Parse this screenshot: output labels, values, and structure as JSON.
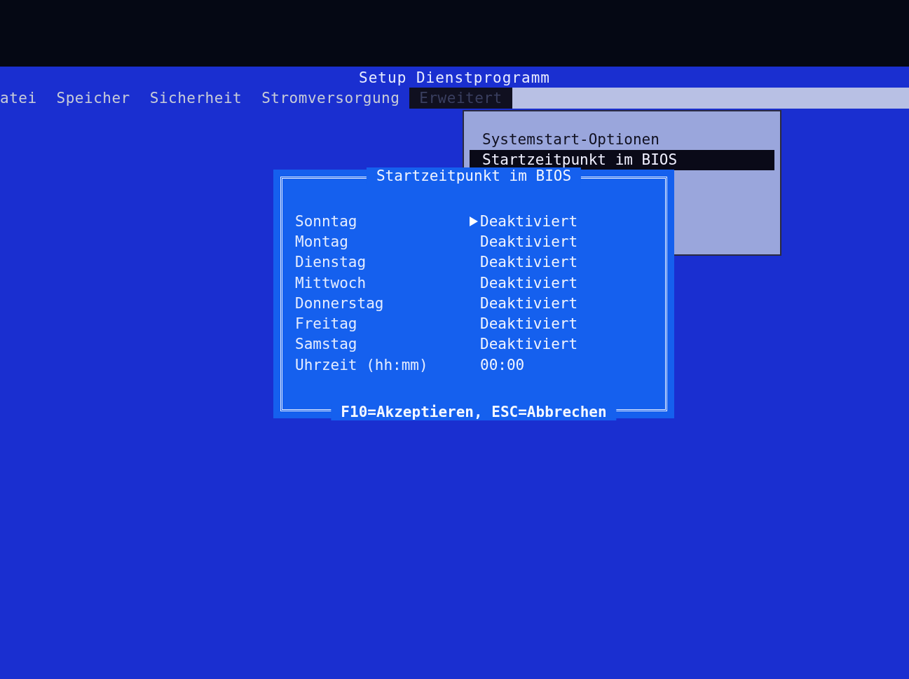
{
  "window": {
    "title": "Setup Dienstprogramm"
  },
  "menu_bar": [
    {
      "label": "atei",
      "selected": false
    },
    {
      "label": "Speicher",
      "selected": false
    },
    {
      "label": "Sicherheit",
      "selected": false
    },
    {
      "label": "Stromversorgung",
      "selected": false
    },
    {
      "label": "Erweitert",
      "selected": true
    }
  ],
  "dropdown": {
    "items": [
      {
        "label": "Systemstart-Optionen",
        "selected": false
      },
      {
        "label": "Startzeitpunkt im BIOS",
        "selected": true
      }
    ]
  },
  "dialog": {
    "title": "Startzeitpunkt im BIOS",
    "rows": [
      {
        "label": "Sonntag",
        "value": "Deaktiviert",
        "selected": true
      },
      {
        "label": "Montag",
        "value": "Deaktiviert",
        "selected": false
      },
      {
        "label": "Dienstag",
        "value": "Deaktiviert",
        "selected": false
      },
      {
        "label": "Mittwoch",
        "value": "Deaktiviert",
        "selected": false
      },
      {
        "label": "Donnerstag",
        "value": "Deaktiviert",
        "selected": false
      },
      {
        "label": "Freitag",
        "value": "Deaktiviert",
        "selected": false
      },
      {
        "label": "Samstag",
        "value": "Deaktiviert",
        "selected": false
      },
      {
        "label": "Uhrzeit (hh:mm)",
        "value": "00:00",
        "selected": false
      }
    ],
    "footer": "F10=Akzeptieren, ESC=Abbrechen"
  }
}
